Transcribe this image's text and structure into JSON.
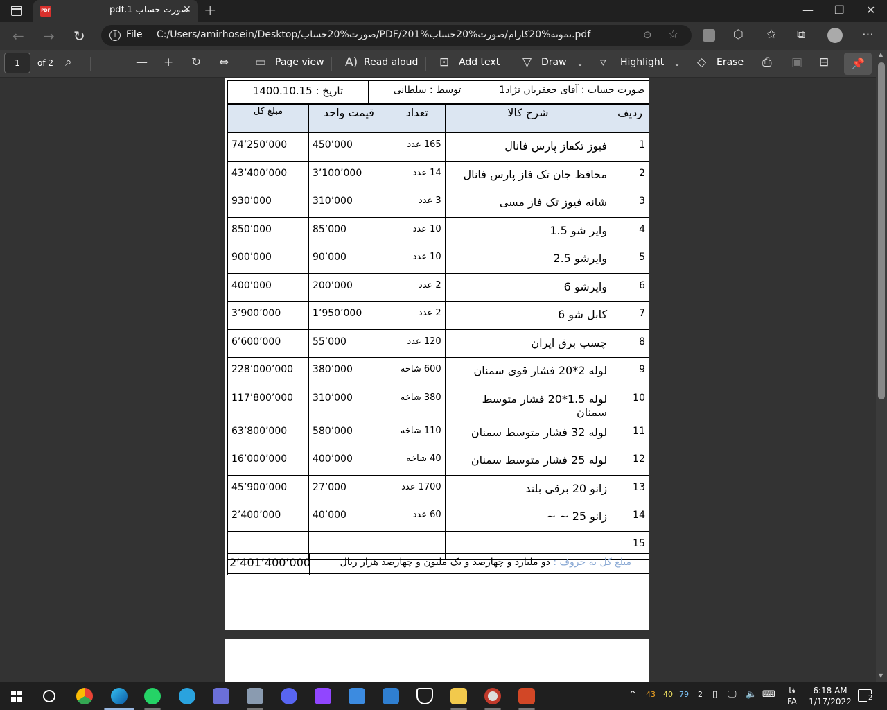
{
  "browser": {
    "tab_title": "صورت حساب 1.pdf",
    "url_scheme_label": "File",
    "url": "C:/Users/amirhosein/Desktop/صورت%20حساب/PDF/201%نمونه%20کارام/صورت%20حساب.pdf"
  },
  "pdf_toolbar": {
    "page_current": "1",
    "page_total": "of 2",
    "page_view": "Page view",
    "read_aloud": "Read aloud",
    "add_text": "Add text",
    "draw": "Draw",
    "highlight": "Highlight",
    "erase": "Erase"
  },
  "invoice": {
    "header": {
      "title": "صورت حساب : آقای جعفریان نژاد1",
      "by": "توسط : سلطانی",
      "date": "تاریخ : 1400.10.15"
    },
    "columns": {
      "index": "ردیف",
      "description": "شرح کالا",
      "quantity": "تعداد",
      "unit_price": "قیمت واحد",
      "total": "مبلغ کل"
    },
    "rows": [
      {
        "idx": "1",
        "desc": "فیوز تکفاز پارس فانال",
        "qty": "165 عدد",
        "price": "450’000",
        "total": "74’250’000"
      },
      {
        "idx": "2",
        "desc": "محافظ جان تک فاز پارس فانال",
        "qty": "14 عدد",
        "price": "3’100’000",
        "total": "43’400’000"
      },
      {
        "idx": "3",
        "desc": "شانه فیوز تک فاز مسی",
        "qty": "3 عدد",
        "price": "310’000",
        "total": "930’000"
      },
      {
        "idx": "4",
        "desc": "وایر شو 1.5",
        "qty": "10 عدد",
        "price": "85’000",
        "total": "850’000"
      },
      {
        "idx": "5",
        "desc": "وایرشو 2.5",
        "qty": "10 عدد",
        "price": "90’000",
        "total": "900’000"
      },
      {
        "idx": "6",
        "desc": "وایرشو 6",
        "qty": "2 عدد",
        "price": "200’000",
        "total": "400’000"
      },
      {
        "idx": "7",
        "desc": "کابل شو 6",
        "qty": "2 عدد",
        "price": "1’950’000",
        "total": "3’900’000"
      },
      {
        "idx": "8",
        "desc": "چسب برق ایران",
        "qty": "120 عدد",
        "price": "55’000",
        "total": "6’600’000"
      },
      {
        "idx": "9",
        "desc": "لوله 2*20  فشار قوی سمنان",
        "qty": "600 شاخه",
        "price": "380’000",
        "total": "228’000’000"
      },
      {
        "idx": "10",
        "desc": "لوله 1.5*20 فشار متوسط سمنان",
        "qty": "380 شاخه",
        "price": "310’000",
        "total": "117’800’000"
      },
      {
        "idx": "11",
        "desc": "لوله 32 فشار متوسط سمنان",
        "qty": "110 شاخه",
        "price": "580’000",
        "total": "63’800’000"
      },
      {
        "idx": "12",
        "desc": "لوله 25 فشار متوسط سمنان",
        "qty": "40 شاخه",
        "price": "400’000",
        "total": "16’000’000"
      },
      {
        "idx": "13",
        "desc": "زانو 20 برقی بلند",
        "qty": "1700 عدد",
        "price": "27’000",
        "total": "45’900’000"
      },
      {
        "idx": "14",
        "desc": "زانو 25 ~      ~",
        "qty": "60 عدد",
        "price": "40’000",
        "total": "2’400’000"
      },
      {
        "idx": "15",
        "desc": "",
        "qty": "",
        "price": "",
        "total": ""
      }
    ],
    "sum_label": "مبلغ کل به حروف :",
    "sum_words": " دو ملیارد و چهارصد و یک ملیون و چهارصد هزار ریال",
    "sum_amount": "2’401’400’000"
  },
  "taskbar": {
    "tray_numbers": [
      "43",
      "40",
      "79",
      "2"
    ],
    "lang_top": "فا",
    "lang_bottom": "FA",
    "time": "6:18 AM",
    "date": "1/17/2022",
    "notifications": "2"
  }
}
